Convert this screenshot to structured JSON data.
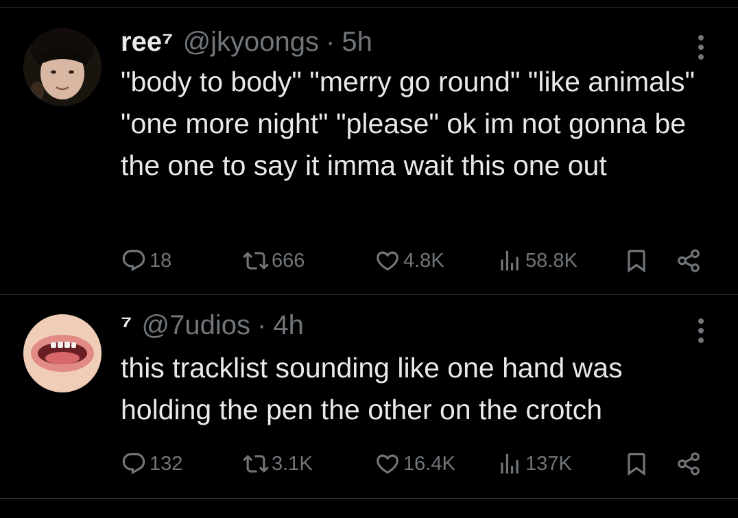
{
  "colors": {
    "background": "#000000",
    "primary_text": "#e7e9ea",
    "secondary_text": "#71767b",
    "divider": "#2f3336"
  },
  "tweets": [
    {
      "display_name": "ree⁷",
      "handle": "@jkyoongs",
      "separator": "·",
      "time": "5h",
      "text": "\"body to body\" \"merry go round\" \"like animals\" \"one more night\" \"please\" ok im not gonna be the one to say it imma wait this one out",
      "avatar_icon": "avatar-photo-face",
      "replies": "18",
      "retweets": "666",
      "likes": "4.8K",
      "views": "58.8K"
    },
    {
      "display_name": "⁷",
      "handle": "@7udios",
      "separator": "·",
      "time": "4h",
      "text": "this tracklist sounding like one hand was holding the pen the other on the crotch",
      "avatar_icon": "avatar-photo-mouth",
      "replies": "132",
      "retweets": "3.1K",
      "likes": "16.4K",
      "views": "137K"
    }
  ],
  "icons": {
    "reply": "reply-icon",
    "retweet": "retweet-icon",
    "like": "heart-icon",
    "views": "views-icon",
    "bookmark": "bookmark-icon",
    "share": "share-icon",
    "more": "more-icon"
  }
}
